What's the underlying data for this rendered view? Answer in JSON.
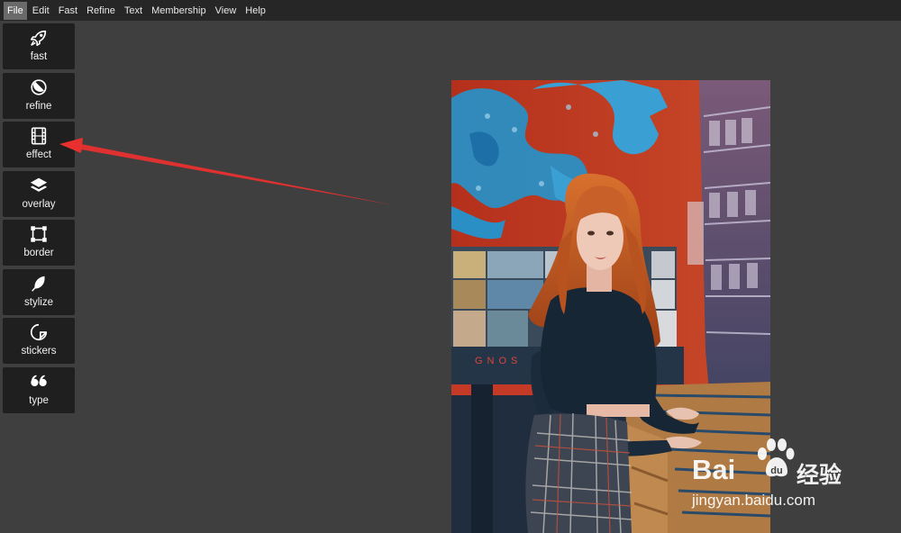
{
  "menubar": {
    "items": [
      {
        "label": "File",
        "active": true
      },
      {
        "label": "Edit"
      },
      {
        "label": "Fast"
      },
      {
        "label": "Refine"
      },
      {
        "label": "Text"
      },
      {
        "label": "Membership"
      },
      {
        "label": "View"
      },
      {
        "label": "Help"
      }
    ]
  },
  "sidebar": {
    "tools": [
      {
        "label": "fast",
        "icon": "rocket-icon"
      },
      {
        "label": "refine",
        "icon": "refine-icon"
      },
      {
        "label": "effect",
        "icon": "film-icon"
      },
      {
        "label": "overlay",
        "icon": "layers-icon"
      },
      {
        "label": "border",
        "icon": "border-icon"
      },
      {
        "label": "stylize",
        "icon": "feather-icon"
      },
      {
        "label": "stickers",
        "icon": "sticker-icon"
      },
      {
        "label": "type",
        "icon": "quote-icon"
      }
    ]
  },
  "annotation": {
    "color": "#e8302f"
  },
  "watermark": {
    "brand": "Bai",
    "brand_suffix": "du",
    "chinese": "经验",
    "url": "jingyan.baidu.com"
  },
  "colors": {
    "menubar_bg": "#262626",
    "canvas_bg": "#3f3f3f",
    "tool_bg": "#1f1f1f"
  }
}
